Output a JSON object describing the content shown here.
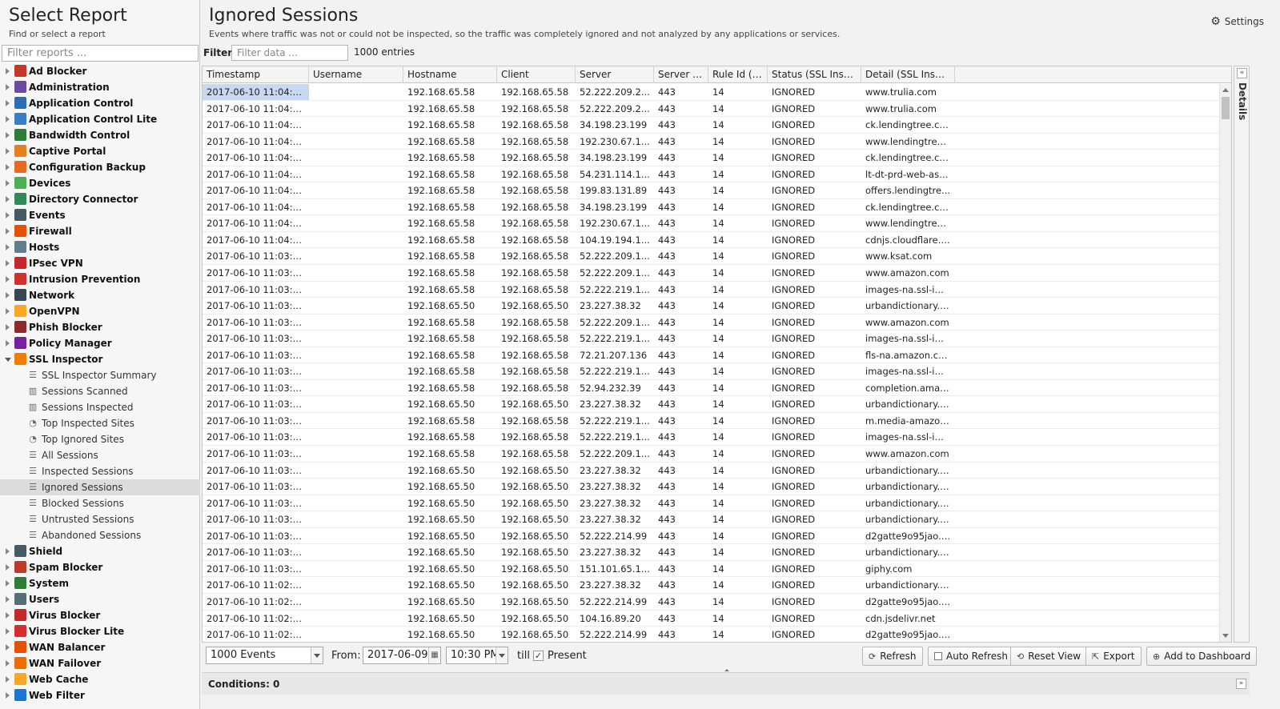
{
  "left_panel": {
    "title": "Select Report",
    "subtitle": "Find or select a report",
    "filter_placeholder": "Filter reports ...",
    "categories": [
      {
        "label": "Ad Blocker",
        "color": "#c0392b",
        "icon": "ad-blocker-icon"
      },
      {
        "label": "Administration",
        "color": "#6b4aa0",
        "icon": "administration-icon"
      },
      {
        "label": "Application Control",
        "color": "#2d6db5",
        "icon": "application-control-icon"
      },
      {
        "label": "Application Control Lite",
        "color": "#3a7cc7",
        "icon": "application-control-lite-icon"
      },
      {
        "label": "Bandwidth Control",
        "color": "#2e7d32",
        "icon": "bandwidth-control-icon"
      },
      {
        "label": "Captive Portal",
        "color": "#e67e22",
        "icon": "captive-portal-icon"
      },
      {
        "label": "Configuration Backup",
        "color": "#e66a1f",
        "icon": "configuration-backup-icon"
      },
      {
        "label": "Devices",
        "color": "#4caf50",
        "icon": "devices-icon"
      },
      {
        "label": "Directory Connector",
        "color": "#2e8b57",
        "icon": "directory-connector-icon"
      },
      {
        "label": "Events",
        "color": "#455a64",
        "icon": "events-icon"
      },
      {
        "label": "Firewall",
        "color": "#e65100",
        "icon": "firewall-icon"
      },
      {
        "label": "Hosts",
        "color": "#607d8b",
        "icon": "hosts-icon"
      },
      {
        "label": "IPsec VPN",
        "color": "#c62828",
        "icon": "ipsec-vpn-icon"
      },
      {
        "label": "Intrusion Prevention",
        "color": "#d32f2f",
        "icon": "intrusion-prevention-icon"
      },
      {
        "label": "Network",
        "color": "#37474f",
        "icon": "network-icon"
      },
      {
        "label": "OpenVPN",
        "color": "#f9a825",
        "icon": "openvpn-icon"
      },
      {
        "label": "Phish Blocker",
        "color": "#8d2a2a",
        "icon": "phish-blocker-icon"
      },
      {
        "label": "Policy Manager",
        "color": "#7b1fa2",
        "icon": "policy-manager-icon"
      },
      {
        "label": "SSL Inspector",
        "color": "#f57c00",
        "icon": "ssl-inspector-icon",
        "open": true,
        "children": [
          {
            "label": "SSL Inspector Summary",
            "icon": "summary-lines-icon"
          },
          {
            "label": "Sessions Scanned",
            "icon": "bar-chart-icon"
          },
          {
            "label": "Sessions Inspected",
            "icon": "bar-chart-icon"
          },
          {
            "label": "Top Inspected Sites",
            "icon": "pie-chart-icon"
          },
          {
            "label": "Top Ignored Sites",
            "icon": "pie-chart-icon"
          },
          {
            "label": "All Sessions",
            "icon": "list-icon"
          },
          {
            "label": "Inspected Sessions",
            "icon": "list-icon"
          },
          {
            "label": "Ignored Sessions",
            "icon": "list-icon",
            "selected": true
          },
          {
            "label": "Blocked Sessions",
            "icon": "list-icon"
          },
          {
            "label": "Untrusted Sessions",
            "icon": "list-icon"
          },
          {
            "label": "Abandoned Sessions",
            "icon": "list-icon"
          }
        ]
      },
      {
        "label": "Shield",
        "color": "#455a64",
        "icon": "shield-icon"
      },
      {
        "label": "Spam Blocker",
        "color": "#c0392b",
        "icon": "spam-blocker-icon"
      },
      {
        "label": "System",
        "color": "#2e7d32",
        "icon": "system-icon"
      },
      {
        "label": "Users",
        "color": "#546e7a",
        "icon": "users-icon"
      },
      {
        "label": "Virus Blocker",
        "color": "#c62828",
        "icon": "virus-blocker-icon"
      },
      {
        "label": "Virus Blocker Lite",
        "color": "#d32f2f",
        "icon": "virus-blocker-lite-icon"
      },
      {
        "label": "WAN Balancer",
        "color": "#e65100",
        "icon": "wan-balancer-icon"
      },
      {
        "label": "WAN Failover",
        "color": "#ef6c00",
        "icon": "wan-failover-icon"
      },
      {
        "label": "Web Cache",
        "color": "#f9a825",
        "icon": "web-cache-icon"
      },
      {
        "label": "Web Filter",
        "color": "#1976d2",
        "icon": "web-filter-icon"
      }
    ]
  },
  "main": {
    "title": "Ignored Sessions",
    "description": "Events where traffic was not or could not be inspected, so the traffic was completely ignored and not analyzed by any applications or services.",
    "settings_label": "Settings",
    "filter_label": "Filter:",
    "filter_placeholder": "Filter data ...",
    "entries_count": "1000 entries",
    "details_label": "Details",
    "columns": [
      "Timestamp",
      "Username",
      "Hostname",
      "Client",
      "Server",
      "Server P...",
      "Rule Id (S...",
      "Status (SSL Insp...",
      "Detail (SSL Inspe..."
    ],
    "rows": [
      [
        "2017-06-10 11:04:3...",
        "",
        "192.168.65.58",
        "192.168.65.58",
        "52.222.209.2...",
        "443",
        "14",
        "IGNORED",
        "www.trulia.com"
      ],
      [
        "2017-06-10 11:04:2...",
        "",
        "192.168.65.58",
        "192.168.65.58",
        "52.222.209.2...",
        "443",
        "14",
        "IGNORED",
        "www.trulia.com"
      ],
      [
        "2017-06-10 11:04:2...",
        "",
        "192.168.65.58",
        "192.168.65.58",
        "34.198.23.199",
        "443",
        "14",
        "IGNORED",
        "ck.lendingtree.com"
      ],
      [
        "2017-06-10 11:04:2...",
        "",
        "192.168.65.58",
        "192.168.65.58",
        "192.230.67.1...",
        "443",
        "14",
        "IGNORED",
        "www.lendingtree...."
      ],
      [
        "2017-06-10 11:04:2...",
        "",
        "192.168.65.58",
        "192.168.65.58",
        "34.198.23.199",
        "443",
        "14",
        "IGNORED",
        "ck.lendingtree.com"
      ],
      [
        "2017-06-10 11:04:2...",
        "",
        "192.168.65.58",
        "192.168.65.58",
        "54.231.114.1...",
        "443",
        "14",
        "IGNORED",
        "lt-dt-prd-web-ass..."
      ],
      [
        "2017-06-10 11:04:2...",
        "",
        "192.168.65.58",
        "192.168.65.58",
        "199.83.131.89",
        "443",
        "14",
        "IGNORED",
        "offers.lendingtre..."
      ],
      [
        "2017-06-10 11:04:2...",
        "",
        "192.168.65.58",
        "192.168.65.58",
        "34.198.23.199",
        "443",
        "14",
        "IGNORED",
        "ck.lendingtree.com"
      ],
      [
        "2017-06-10 11:04:2...",
        "",
        "192.168.65.58",
        "192.168.65.58",
        "192.230.67.1...",
        "443",
        "14",
        "IGNORED",
        "www.lendingtree...."
      ],
      [
        "2017-06-10 11:04:2...",
        "",
        "192.168.65.58",
        "192.168.65.58",
        "104.19.194.1...",
        "443",
        "14",
        "IGNORED",
        "cdnjs.cloudflare.c..."
      ],
      [
        "2017-06-10 11:03:4...",
        "",
        "192.168.65.58",
        "192.168.65.58",
        "52.222.209.1...",
        "443",
        "14",
        "IGNORED",
        "www.ksat.com"
      ],
      [
        "2017-06-10 11:03:2...",
        "",
        "192.168.65.58",
        "192.168.65.58",
        "52.222.209.1...",
        "443",
        "14",
        "IGNORED",
        "www.amazon.com"
      ],
      [
        "2017-06-10 11:03:2...",
        "",
        "192.168.65.58",
        "192.168.65.58",
        "52.222.219.1...",
        "443",
        "14",
        "IGNORED",
        "images-na.ssl-im..."
      ],
      [
        "2017-06-10 11:03:1...",
        "",
        "192.168.65.50",
        "192.168.65.50",
        "23.227.38.32",
        "443",
        "14",
        "IGNORED",
        "urbandictionary.s..."
      ],
      [
        "2017-06-10 11:03:1...",
        "",
        "192.168.65.58",
        "192.168.65.58",
        "52.222.209.1...",
        "443",
        "14",
        "IGNORED",
        "www.amazon.com"
      ],
      [
        "2017-06-10 11:03:1...",
        "",
        "192.168.65.58",
        "192.168.65.58",
        "52.222.219.1...",
        "443",
        "14",
        "IGNORED",
        "images-na.ssl-im..."
      ],
      [
        "2017-06-10 11:03:1...",
        "",
        "192.168.65.58",
        "192.168.65.58",
        "72.21.207.136",
        "443",
        "14",
        "IGNORED",
        "fls-na.amazon.com"
      ],
      [
        "2017-06-10 11:03:1...",
        "",
        "192.168.65.58",
        "192.168.65.58",
        "52.222.219.1...",
        "443",
        "14",
        "IGNORED",
        "images-na.ssl-im..."
      ],
      [
        "2017-06-10 11:03:1...",
        "",
        "192.168.65.58",
        "192.168.65.58",
        "52.94.232.39",
        "443",
        "14",
        "IGNORED",
        "completion.amaz..."
      ],
      [
        "2017-06-10 11:03:1...",
        "",
        "192.168.65.50",
        "192.168.65.50",
        "23.227.38.32",
        "443",
        "14",
        "IGNORED",
        "urbandictionary.s..."
      ],
      [
        "2017-06-10 11:03:1...",
        "",
        "192.168.65.58",
        "192.168.65.58",
        "52.222.219.1...",
        "443",
        "14",
        "IGNORED",
        "m.media-amazon..."
      ],
      [
        "2017-06-10 11:03:1...",
        "",
        "192.168.65.58",
        "192.168.65.58",
        "52.222.219.1...",
        "443",
        "14",
        "IGNORED",
        "images-na.ssl-im..."
      ],
      [
        "2017-06-10 11:03:1...",
        "",
        "192.168.65.58",
        "192.168.65.58",
        "52.222.209.1...",
        "443",
        "14",
        "IGNORED",
        "www.amazon.com"
      ],
      [
        "2017-06-10 11:03:1...",
        "",
        "192.168.65.50",
        "192.168.65.50",
        "23.227.38.32",
        "443",
        "14",
        "IGNORED",
        "urbandictionary.s..."
      ],
      [
        "2017-06-10 11:03:1...",
        "",
        "192.168.65.50",
        "192.168.65.50",
        "23.227.38.32",
        "443",
        "14",
        "IGNORED",
        "urbandictionary.s..."
      ],
      [
        "2017-06-10 11:03:0...",
        "",
        "192.168.65.50",
        "192.168.65.50",
        "23.227.38.32",
        "443",
        "14",
        "IGNORED",
        "urbandictionary.s..."
      ],
      [
        "2017-06-10 11:03:0...",
        "",
        "192.168.65.50",
        "192.168.65.50",
        "23.227.38.32",
        "443",
        "14",
        "IGNORED",
        "urbandictionary.s..."
      ],
      [
        "2017-06-10 11:03:0...",
        "",
        "192.168.65.50",
        "192.168.65.50",
        "52.222.214.99",
        "443",
        "14",
        "IGNORED",
        "d2gatte9o95jao.c..."
      ],
      [
        "2017-06-10 11:03:0...",
        "",
        "192.168.65.50",
        "192.168.65.50",
        "23.227.38.32",
        "443",
        "14",
        "IGNORED",
        "urbandictionary.s..."
      ],
      [
        "2017-06-10 11:03:0...",
        "",
        "192.168.65.50",
        "192.168.65.50",
        "151.101.65.1...",
        "443",
        "14",
        "IGNORED",
        "giphy.com"
      ],
      [
        "2017-06-10 11:02:5...",
        "",
        "192.168.65.50",
        "192.168.65.50",
        "23.227.38.32",
        "443",
        "14",
        "IGNORED",
        "urbandictionary.s..."
      ],
      [
        "2017-06-10 11:02:5...",
        "",
        "192.168.65.50",
        "192.168.65.50",
        "52.222.214.99",
        "443",
        "14",
        "IGNORED",
        "d2gatte9o95jao.c..."
      ],
      [
        "2017-06-10 11:02:5...",
        "",
        "192.168.65.50",
        "192.168.65.50",
        "104.16.89.20",
        "443",
        "14",
        "IGNORED",
        "cdn.jsdelivr.net"
      ],
      [
        "2017-06-10 11:02:5...",
        "",
        "192.168.65.50",
        "192.168.65.50",
        "52.222.214.99",
        "443",
        "14",
        "IGNORED",
        "d2gatte9o95jao.c..."
      ]
    ]
  },
  "toolbar": {
    "events_select": "1000 Events",
    "from_label": "From:",
    "from_date": "2017-06-09",
    "from_time": "10:30 PM",
    "till_label": "till",
    "present_checked": true,
    "present_label": "Present",
    "refresh_label": "Refresh",
    "auto_refresh_label": "Auto Refresh",
    "reset_view_label": "Reset View",
    "export_label": "Export",
    "add_dashboard_label": "Add to Dashboard"
  },
  "conditions": {
    "text": "Conditions: 0"
  }
}
